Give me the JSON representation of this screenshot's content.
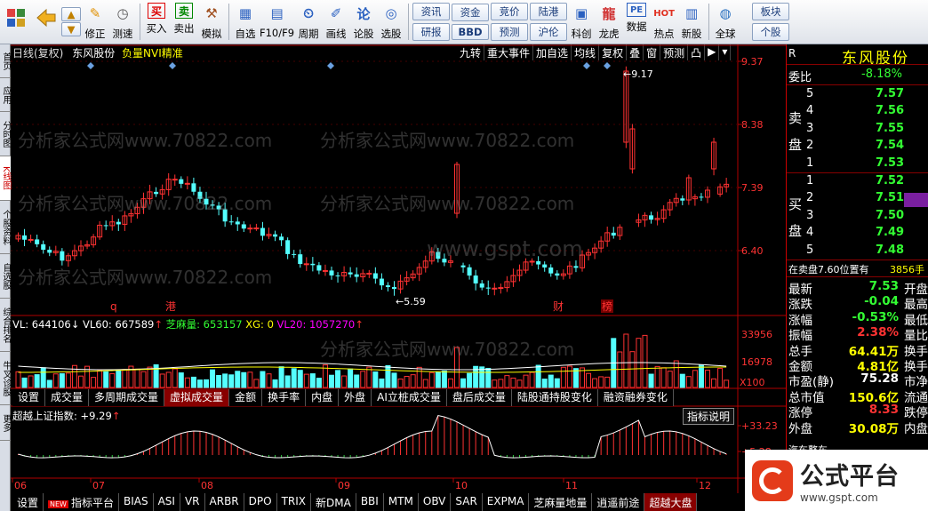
{
  "toolbar": {
    "items": [
      {
        "label": "修正",
        "icon": "pencil-icon"
      },
      {
        "label": "测速",
        "icon": "clock-icon"
      },
      {
        "label": "买入",
        "icon": "buy-icon"
      },
      {
        "label": "卖出",
        "icon": "sell-icon"
      },
      {
        "label": "模拟",
        "icon": "hammer-icon"
      },
      {
        "label": "自选",
        "icon": "star-icon"
      },
      {
        "label": "F10/F9",
        "icon": "f10-icon"
      },
      {
        "label": "周期",
        "icon": "period-icon"
      },
      {
        "label": "画线",
        "icon": "draw-icon"
      },
      {
        "label": "论股",
        "icon": "comment-icon"
      },
      {
        "label": "选股",
        "icon": "pick-icon"
      },
      {
        "label": "科创",
        "icon": "tech-icon"
      },
      {
        "label": "龙虎",
        "icon": "dragon-icon"
      },
      {
        "label": "数据",
        "icon": "pe-icon"
      },
      {
        "label": "热点",
        "icon": "hot-icon"
      },
      {
        "label": "新股",
        "icon": "newstock-icon"
      },
      {
        "label": "全球",
        "icon": "globe-icon"
      }
    ],
    "pairs": [
      [
        "资讯",
        "研报"
      ],
      [
        "资金",
        "BBD"
      ],
      [
        "竞价",
        "预测"
      ],
      [
        "陆港",
        "沪伦"
      ]
    ],
    "right_pair": [
      "板块",
      "个股"
    ]
  },
  "left_tabs": [
    "首页",
    "应用",
    "分时图",
    "K线图",
    "个股资料",
    "自选股",
    "综合排名",
    "牛叉诊股",
    "更多"
  ],
  "chart_header": {
    "period": "日线(复权)",
    "name": "东风股份",
    "indicator": "负量NVI精准",
    "buttons": [
      "九转",
      "重大事件",
      "加自选",
      "均线",
      "复权",
      "叠",
      "窗",
      "预测",
      "凸",
      "▶︎"
    ]
  },
  "price_axis": [
    "9.37",
    "8.38",
    "7.39",
    "6.40"
  ],
  "price_annotations": {
    "high": "9.17",
    "low": "5.59"
  },
  "event_markers": [
    "q",
    "港",
    "财",
    "榜"
  ],
  "volume_header": {
    "vl": "VL: 644106",
    "vl60": "VL60: 667589",
    "zhima": "芝麻量: 653157",
    "xg": "XG: 0",
    "vl20": "VL20: 1057270"
  },
  "volume_axis": [
    "33956",
    "16978",
    "X100"
  ],
  "vol_tabs": [
    "设置",
    "成交量",
    "多周期成交量",
    "虚拟成交量",
    "金额",
    "换手率",
    "内盘",
    "外盘",
    "AI立桩成交量",
    "盘后成交量",
    "陆股通持股变化",
    "融资融券变化"
  ],
  "indicator_header": {
    "text": "超越上证指数: +9.29",
    "button": "指标说明"
  },
  "indicator_axis": [
    "+33.23",
    "+5.28"
  ],
  "date_axis": [
    "06",
    "07",
    "08",
    "09",
    "10",
    "11",
    "12"
  ],
  "bottom_tabs": [
    "设置",
    "指标平台",
    "BIAS",
    "ASI",
    "VR",
    "ARBR",
    "DPO",
    "TRIX",
    "新DMA",
    "BBI",
    "MTM",
    "OBV",
    "SAR",
    "EXPMA",
    "芝麻量地量",
    "逍遥前途",
    "超越大盘"
  ],
  "bottom_new_badge": "NEW",
  "quote": {
    "title": "东风股份",
    "weibi_label": "委比",
    "weibi": "-8.18%",
    "sell_label": "卖盘",
    "buy_label": "买盘",
    "sells": [
      [
        "5",
        "7.57"
      ],
      [
        "4",
        "7.56"
      ],
      [
        "3",
        "7.55"
      ],
      [
        "2",
        "7.54"
      ],
      [
        "1",
        "7.53"
      ]
    ],
    "buys": [
      [
        "1",
        "7.52"
      ],
      [
        "2",
        "7.51"
      ],
      [
        "3",
        "7.50"
      ],
      [
        "4",
        "7.49"
      ],
      [
        "5",
        "7.48"
      ]
    ],
    "note": "在卖盘7.60位置有",
    "note_value": "3856手",
    "stats": [
      [
        "最新",
        "7.53",
        "开盘"
      ],
      [
        "涨跌",
        "-0.04",
        "最高"
      ],
      [
        "涨幅",
        "-0.53%",
        "最低"
      ],
      [
        "振幅",
        "2.38%",
        "量比"
      ],
      [
        "总手",
        "64.41万",
        "换手"
      ],
      [
        "金额",
        "4.81亿",
        "换手"
      ],
      [
        "市盈(静)",
        "75.28",
        "市净"
      ],
      [
        "总市值",
        "150.6亿",
        "流通"
      ],
      [
        "涨停",
        "8.33",
        "跌停"
      ],
      [
        "外盘",
        "30.08万",
        "内盘"
      ]
    ],
    "industry": "汽车整车",
    "r_label": "R"
  },
  "logo": {
    "name": "公式平台",
    "url": "www.gspt.com"
  },
  "watermarks": [
    "分析家公式网www.70822.com",
    "www.gspt.com"
  ],
  "colors": {
    "up": "#ff3232",
    "down": "#54ffff",
    "bg": "#000000",
    "axis": "#b00000"
  }
}
